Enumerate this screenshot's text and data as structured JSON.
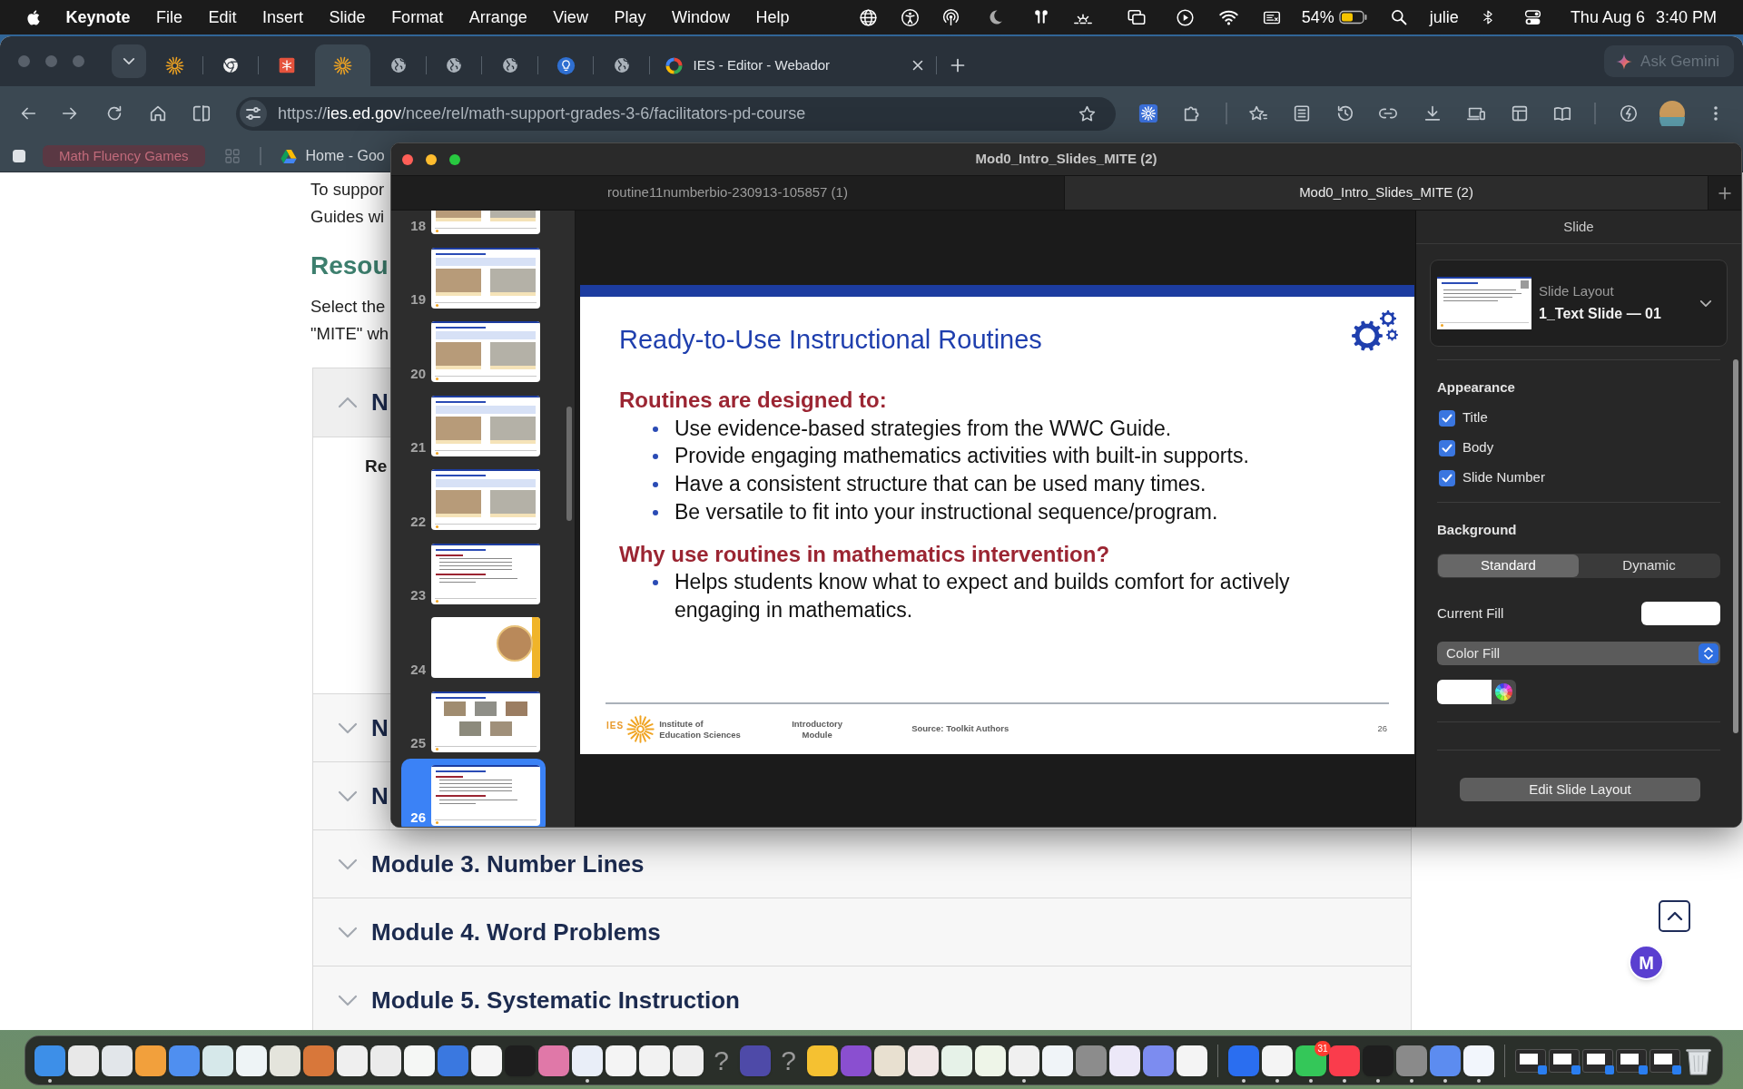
{
  "menu_bar": {
    "app_name": "Keynote",
    "menus": [
      "File",
      "Edit",
      "Insert",
      "Slide",
      "Format",
      "Arrange",
      "View",
      "Play",
      "Window",
      "Help"
    ],
    "battery": "54%",
    "user": "julie",
    "date": "Thu Aug 6",
    "time": "3:40 PM"
  },
  "browser": {
    "tabs": [
      {
        "selected": false
      },
      {
        "selected": false
      },
      {
        "selected": false
      },
      {
        "selected": true
      },
      {
        "selected": false
      },
      {
        "selected": false
      },
      {
        "selected": false
      },
      {
        "selected": false
      },
      {
        "selected": false
      },
      {
        "title": "IES - Editor - Webador",
        "selected": false
      }
    ],
    "gemini_button": "Ask Gemini",
    "url": {
      "scheme": "https://",
      "host": "ies.ed.gov",
      "path": "/ncee/rel/math-support-grades-3-6/facilitators-pd-course"
    },
    "bookmarks": [
      {
        "kind": "group",
        "label": "Math Fluency Games"
      },
      {
        "kind": "link",
        "label": "Home - Goo"
      }
    ]
  },
  "page": {
    "intro_lines": [
      "To suppor",
      "Guides wi"
    ],
    "heading": "Resou",
    "select_lines": [
      "Select the",
      "\"MITE\" wh"
    ],
    "accordion": [
      {
        "title": "N",
        "expanded": true,
        "content": "Re"
      },
      {
        "title": "N",
        "expanded": false
      },
      {
        "title": "N",
        "expanded": false
      },
      {
        "title": "Module 3. Number Lines",
        "expanded": false
      },
      {
        "title": "Module 4. Word Problems",
        "expanded": false
      },
      {
        "title": "Module 5. Systematic Instruction",
        "expanded": false
      }
    ],
    "assistant_button": "M"
  },
  "keynote": {
    "title": "Mod0_Intro_Slides_MITE (2)",
    "tabs": [
      {
        "title": "routine11numberbio-230913-105857 (1)",
        "selected": false
      },
      {
        "title": "Mod0_Intro_Slides_MITE (2)",
        "selected": true
      }
    ],
    "slides": [
      {
        "number": "18",
        "kind": "photos",
        "selected": false
      },
      {
        "number": "19",
        "kind": "photos",
        "selected": false
      },
      {
        "number": "20",
        "kind": "photos",
        "selected": false
      },
      {
        "number": "21",
        "kind": "photos",
        "selected": false
      },
      {
        "number": "22",
        "kind": "photos",
        "selected": false
      },
      {
        "number": "23",
        "kind": "text",
        "selected": false
      },
      {
        "number": "24",
        "kind": "section",
        "selected": false
      },
      {
        "number": "25",
        "kind": "grid",
        "selected": false
      },
      {
        "number": "26",
        "kind": "text",
        "selected": true
      }
    ],
    "slide": {
      "title": "Ready-to-Use Instructional Routines",
      "sections": [
        {
          "heading": "Routines are designed to:",
          "bullets": [
            "Use evidence-based strategies from the WWC Guide.",
            "Provide engaging mathematics activities with built-in supports.",
            "Have a consistent structure that can be used many times.",
            "Be versatile to fit into your instructional sequence/program."
          ]
        },
        {
          "heading": "Why use routines in mathematics intervention?",
          "bullets": [
            "Helps students know what to expect and builds comfort for actively engaging in mathematics."
          ]
        }
      ],
      "footer": {
        "acronym": "IES",
        "organization": "Institute of Education Sciences",
        "module": "Introductory Module",
        "source": "Source: Toolkit Authors",
        "slide_number": "26"
      }
    },
    "inspector": {
      "tab": "Slide",
      "layout_label": "Slide Layout",
      "layout_name": "1_Text Slide — 01",
      "appearance_heading": "Appearance",
      "appearance": [
        {
          "label": "Title",
          "checked": true
        },
        {
          "label": "Body",
          "checked": true
        },
        {
          "label": "Slide Number",
          "checked": true
        }
      ],
      "background_heading": "Background",
      "background_modes": [
        {
          "label": "Standard",
          "selected": true
        },
        {
          "label": "Dynamic",
          "selected": false
        }
      ],
      "current_fill_label": "Current Fill",
      "fill_type": "Color Fill",
      "edit_button": "Edit Slide Layout"
    }
  },
  "dock": [
    {
      "kind": "app",
      "color": "#3d8fe8",
      "running": true
    },
    {
      "kind": "app",
      "color": "#e8e8e8",
      "running": false
    },
    {
      "kind": "app",
      "color": "#e2e6ea",
      "running": false
    },
    {
      "kind": "app",
      "color": "#f2a03c",
      "running": false
    },
    {
      "kind": "app",
      "color": "#4f8ff0",
      "running": false
    },
    {
      "kind": "app",
      "color": "#d6e8ea",
      "running": false
    },
    {
      "kind": "app",
      "color": "#eef4f6",
      "running": false
    },
    {
      "kind": "app",
      "color": "#e4e4dc",
      "running": false
    },
    {
      "kind": "app",
      "color": "#d8773a",
      "running": false
    },
    {
      "kind": "app",
      "color": "#efefef",
      "running": false
    },
    {
      "kind": "app",
      "color": "#ebebeb",
      "running": false
    },
    {
      "kind": "app",
      "color": "#f5f7f5",
      "running": false
    },
    {
      "kind": "app",
      "color": "#3a78e0",
      "running": false
    },
    {
      "kind": "app",
      "color": "#f5f5f5",
      "running": false
    },
    {
      "kind": "app",
      "color": "#1e1e1e",
      "running": false
    },
    {
      "kind": "app",
      "color": "#e078a8",
      "running": false
    },
    {
      "kind": "app",
      "color": "#e9eef8",
      "running": true
    },
    {
      "kind": "app",
      "color": "#f4f4f4",
      "running": false
    },
    {
      "kind": "app",
      "color": "#f2f2f2",
      "running": false
    },
    {
      "kind": "app",
      "color": "#eeeeee",
      "running": false
    },
    {
      "kind": "missing",
      "glyph": "?",
      "running": false
    },
    {
      "kind": "app",
      "color": "#4e4aa8",
      "running": false
    },
    {
      "kind": "missing",
      "glyph": "?",
      "running": false
    },
    {
      "kind": "app",
      "color": "#f5c131",
      "running": false
    },
    {
      "kind": "app",
      "color": "#8a4fd0",
      "running": false
    },
    {
      "kind": "app",
      "color": "#e8e0d0",
      "running": false
    },
    {
      "kind": "app",
      "color": "#f0e6e6",
      "running": false
    },
    {
      "kind": "app",
      "color": "#e6f2e8",
      "running": false
    },
    {
      "kind": "app",
      "color": "#eef5e8",
      "running": false
    },
    {
      "kind": "app",
      "color": "#f0f0f0",
      "running": true
    },
    {
      "kind": "app",
      "color": "#f0f4f8",
      "running": false
    },
    {
      "kind": "app",
      "color": "#8c8c8c",
      "running": false
    },
    {
      "kind": "app",
      "color": "#ece8f8",
      "running": false
    },
    {
      "kind": "app",
      "color": "#7c8cf0",
      "running": false
    },
    {
      "kind": "app",
      "color": "#f4f4f4",
      "running": false
    },
    {
      "kind": "separator"
    },
    {
      "kind": "app",
      "color": "#2a6ef0",
      "running": true
    },
    {
      "kind": "app",
      "color": "#f4f4f4",
      "running": true
    },
    {
      "kind": "app",
      "color": "#34c759",
      "running": true,
      "badge": "31"
    },
    {
      "kind": "app",
      "color": "#fa3c4c",
      "running": true
    },
    {
      "kind": "app",
      "color": "#1e1e1e",
      "running": true
    },
    {
      "kind": "app",
      "color": "#8a8a8a",
      "running": true
    },
    {
      "kind": "app",
      "color": "#5c8cf0",
      "running": true
    },
    {
      "kind": "app",
      "color": "#f2f6fc",
      "running": true
    },
    {
      "kind": "separator"
    },
    {
      "kind": "window"
    },
    {
      "kind": "window"
    },
    {
      "kind": "window"
    },
    {
      "kind": "window"
    },
    {
      "kind": "window"
    },
    {
      "kind": "trash"
    }
  ]
}
